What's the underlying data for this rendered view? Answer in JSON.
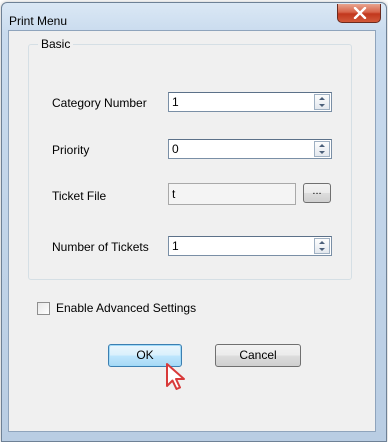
{
  "window": {
    "title": "Print Menu"
  },
  "group": {
    "title": "Basic"
  },
  "fields": {
    "category_number": {
      "label": "Category Number",
      "value": "1"
    },
    "priority": {
      "label": "Priority",
      "value": "0"
    },
    "ticket_file": {
      "label": "Ticket File",
      "value": "t",
      "browse_label": "..."
    },
    "number_of_tickets": {
      "label": "Number of Tickets",
      "value": "1"
    }
  },
  "advanced": {
    "label": "Enable Advanced Settings",
    "checked": false
  },
  "buttons": {
    "ok": "OK",
    "cancel": "Cancel"
  }
}
